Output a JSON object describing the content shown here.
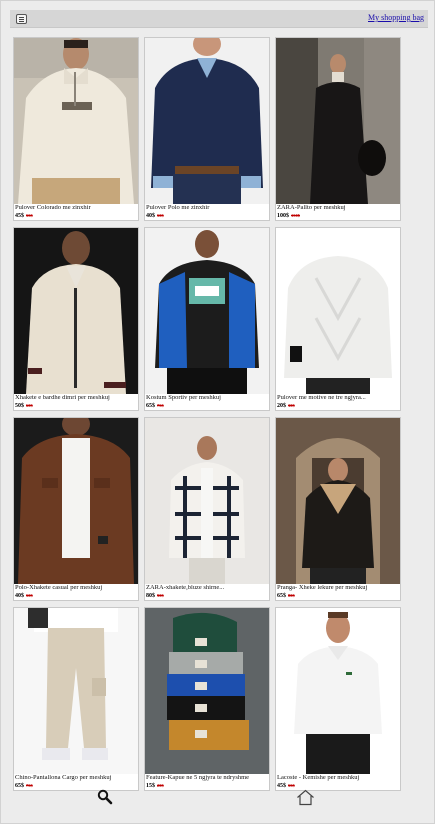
{
  "header": {
    "menu_icon": "menu-icon",
    "bag_link": "My shopping bag"
  },
  "products": [
    {
      "title": "Pulover Colorado me zinxhir",
      "price": "45$",
      "old_price": "55$",
      "image": "white-fleece-half-zip"
    },
    {
      "title": "Pulover Polo me zinxhir",
      "price": "40$",
      "old_price": "50$",
      "image": "navy-polo-sweater"
    },
    {
      "title": "ZARA-Pallto per meshkuj",
      "price": "100$",
      "old_price": "150$",
      "image": "black-long-coat"
    },
    {
      "title": "Xhakete e bardhe dimri per meshkuj",
      "price": "50$",
      "old_price": "60$",
      "image": "cream-sherpa-bomber"
    },
    {
      "title": "Kostum Sportiv per meshkuj",
      "price": "65$",
      "old_price": "75$",
      "image": "blue-black-tracksuit"
    },
    {
      "title": "Pulover me motive ne tre ngjyra...",
      "price": "20$",
      "old_price": "30$",
      "image": "white-cable-knit"
    },
    {
      "title": "Polo-Xhakete casual per meshkuj",
      "price": "40$",
      "old_price": "50$",
      "image": "brown-corduroy-shirt"
    },
    {
      "title": "ZARA-xhakete,bluze shirne...",
      "price": "80$",
      "old_price": "90$",
      "image": "plaid-fleece-jacket"
    },
    {
      "title": "Pranga- Xheke lekure per meshkuj",
      "price": "65$",
      "old_price": "80$",
      "image": "shearling-leather-jacket"
    },
    {
      "title": "Chino-Pantallona Cargo per meshkuj",
      "price": "65$",
      "old_price": "75$",
      "image": "beige-cargo-pants"
    },
    {
      "title": "Feature-Kapue ne 5 ngjyra te ndryshme",
      "price": "15$",
      "old_price": "20$",
      "image": "knit-beanies-stack"
    },
    {
      "title": "Lacoste - Kemishe per meshkuj",
      "price": "45$",
      "old_price": "55$",
      "image": "white-polo-shirt"
    }
  ],
  "nav": {
    "search_icon": "search-icon",
    "home_icon": "home-icon"
  }
}
